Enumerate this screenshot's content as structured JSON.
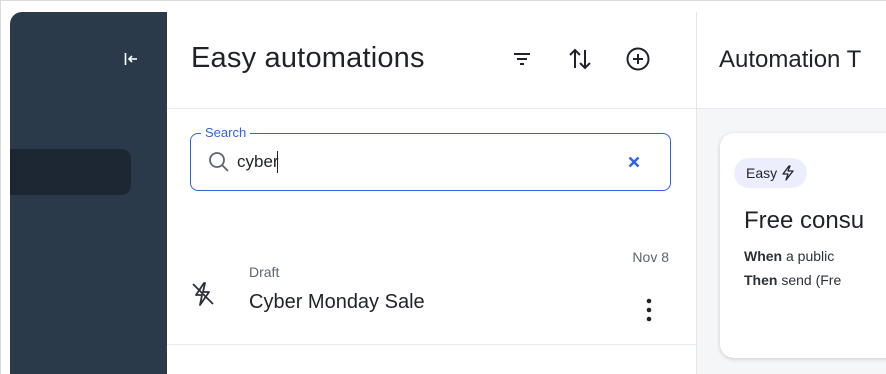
{
  "panel": {
    "title": "Easy automations",
    "search": {
      "label": "Search",
      "value": "cyber",
      "placeholder": "Search"
    }
  },
  "list": {
    "items": [
      {
        "status": "Draft",
        "title": "Cyber Monday Sale",
        "date": "Nov 8"
      }
    ]
  },
  "detail": {
    "title": "Automation T",
    "card": {
      "badge": "Easy",
      "title": "Free consu",
      "when_label": "When",
      "when_text": " a public",
      "then_label": "Then",
      "then_text": " send (Fre"
    }
  },
  "colors": {
    "sidebar": "#2b3a4b",
    "sidebar_active": "#1d2633",
    "accent": "#2f63e4",
    "badge_bg": "#eceefe"
  },
  "icons": {
    "collapse": "collapse-sidebar-icon",
    "filter": "filter-icon",
    "sort": "sort-icon",
    "add": "add-circle-icon",
    "search": "search-icon",
    "clear": "close-icon",
    "item": "automation-off-icon",
    "menu": "more-vertical-icon",
    "badge": "lightning-icon"
  }
}
